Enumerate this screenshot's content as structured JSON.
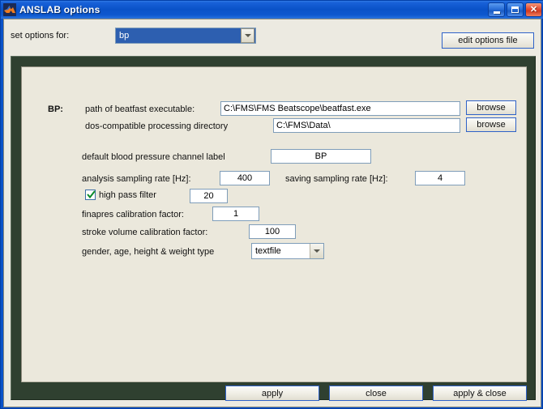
{
  "window": {
    "title": "ANSLAB options",
    "icon": "matlab-logo-icon",
    "titlebar_buttons": {
      "minimize_label": "_",
      "maximize_label": "□",
      "close_label": "✕"
    }
  },
  "colors": {
    "titlebar_blue": "#0a52c8",
    "panel_cream": "#ebe8dc",
    "frame_green": "#2f4030",
    "select_highlight": "#2d5fb0",
    "field_border_blue": "#7f9db9",
    "button_focus_border": "#2f62c8",
    "checkmark_green": "#0a8a2a"
  },
  "top_row": {
    "set_options_label": "set options for:",
    "module_select": {
      "value": "bp",
      "options": [
        "bp"
      ]
    },
    "edit_options_button": "edit options file"
  },
  "panel": {
    "section_label": "BP:",
    "rows": [
      {
        "label": "path of beatfast executable:",
        "value": "C:\\FMS\\FMS Beatscope\\beatfast.exe",
        "browse_label": "browse"
      },
      {
        "label": "dos-compatible processing directory",
        "value": "C:\\FMS\\Data\\",
        "browse_label": "browse"
      }
    ],
    "channel_label_row": {
      "label": "default blood pressure channel label",
      "value": "BP"
    },
    "sampling": {
      "analysis_label": "analysis sampling rate [Hz]:",
      "analysis_value": "400",
      "saving_label": "saving sampling rate [Hz]:",
      "saving_value": "4"
    },
    "high_pass": {
      "label": "high pass filter",
      "checked": true,
      "value": "20"
    },
    "finapres": {
      "label": "finapres calibration factor:",
      "value": "1"
    },
    "stroke_volume": {
      "label": "stroke volume calibration factor:",
      "value": "100"
    },
    "demographics": {
      "label": "gender, age, height & weight  type",
      "value": "textfile",
      "options": [
        "textfile"
      ]
    }
  },
  "actions": {
    "apply_label": "apply",
    "close_label": "close",
    "apply_close_label": "apply & close"
  }
}
